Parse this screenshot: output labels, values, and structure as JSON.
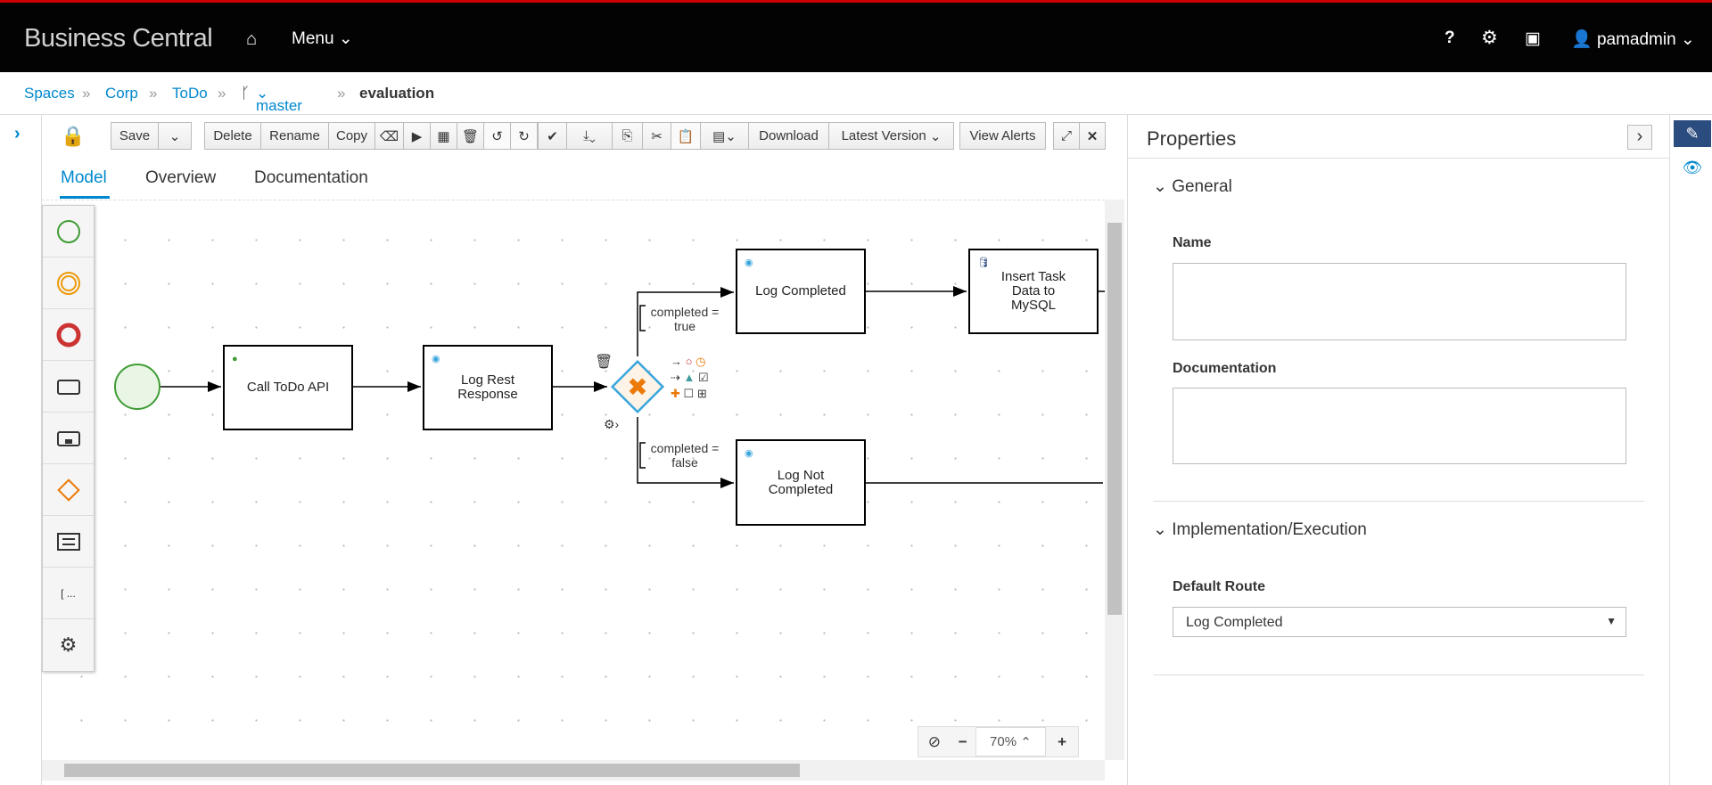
{
  "header": {
    "brand": "Business Central",
    "home_icon": "home-icon",
    "menu": "Menu",
    "help": "?",
    "user": "pamadmin"
  },
  "breadcrumb": {
    "items": [
      "Spaces",
      "Corp",
      "ToDo"
    ],
    "branch": "master",
    "current": "evaluation"
  },
  "toolbar": {
    "save": "Save",
    "delete": "Delete",
    "rename": "Rename",
    "copy": "Copy",
    "download": "Download",
    "latest_version": "Latest Version",
    "view_alerts": "View Alerts"
  },
  "tabs": [
    "Model",
    "Overview",
    "Documentation"
  ],
  "diagram": {
    "nodes": {
      "call_api": "Call ToDo API",
      "log_rest": "Log Rest Response",
      "log_completed": "Log Completed",
      "insert_task": "Insert Task Data to MySQL",
      "log_not_completed": "Log Not Completed"
    },
    "conditions": {
      "true_label": "completed = true",
      "false_label": "completed = false"
    }
  },
  "zoom": {
    "level": "70%"
  },
  "properties": {
    "title": "Properties",
    "general": "General",
    "name_label": "Name",
    "name_value": "",
    "doc_label": "Documentation",
    "doc_value": "",
    "impl_section": "Implementation/Execution",
    "default_route_label": "Default Route",
    "default_route_value": "Log Completed"
  },
  "colors": {
    "accent": "#0088ce",
    "topbar": "#030303",
    "start": "#3f9c35",
    "end": "#cc0000",
    "gateway": "#ec7a08"
  }
}
